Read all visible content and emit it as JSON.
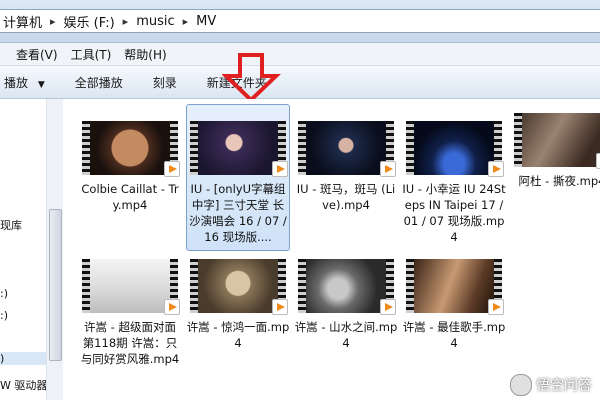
{
  "address": {
    "crumbs": [
      "计算机",
      "娱乐 (F:)",
      "music",
      "MV"
    ]
  },
  "menus": [
    "查看(V)",
    "工具(T)",
    "帮助(H)"
  ],
  "toolbar": {
    "play": "播放",
    "play_all": "全部播放",
    "burn": "刻录",
    "new_folder": "新建文件夹"
  },
  "nav": {
    "items": [
      "现库",
      ":)",
      ":)",
      ")",
      "W 驱动器"
    ]
  },
  "files": [
    {
      "name": "Colbie Caillat - Try.mp4"
    },
    {
      "name": "IU - [onlyU字幕组中字] 三寸天堂 长沙演唱会 16 / 07 / 16 现场版...."
    },
    {
      "name": "IU - 斑马，斑马 (Live).mp4"
    },
    {
      "name": "IU - 小幸运 IU 24Steps IN Taipei 17 / 01 / 07 现场版.mp4"
    },
    {
      "name": "阿杜 - 撕夜.mp4"
    },
    {
      "name": "许嵩 - 超级面对面 第118期 许嵩：只与同好赏风雅.mp4"
    },
    {
      "name": "许嵩 - 惊鸿一面.mp4"
    },
    {
      "name": "许嵩 - 山水之间.mp4"
    },
    {
      "name": "许嵩 - 最佳歌手.mp4"
    }
  ],
  "watermark": {
    "text": "悟空问答"
  },
  "colors": {
    "selection": "#cfe2f8",
    "annotation_arrow": "#e02020",
    "play_badge": "#f08a1a"
  }
}
